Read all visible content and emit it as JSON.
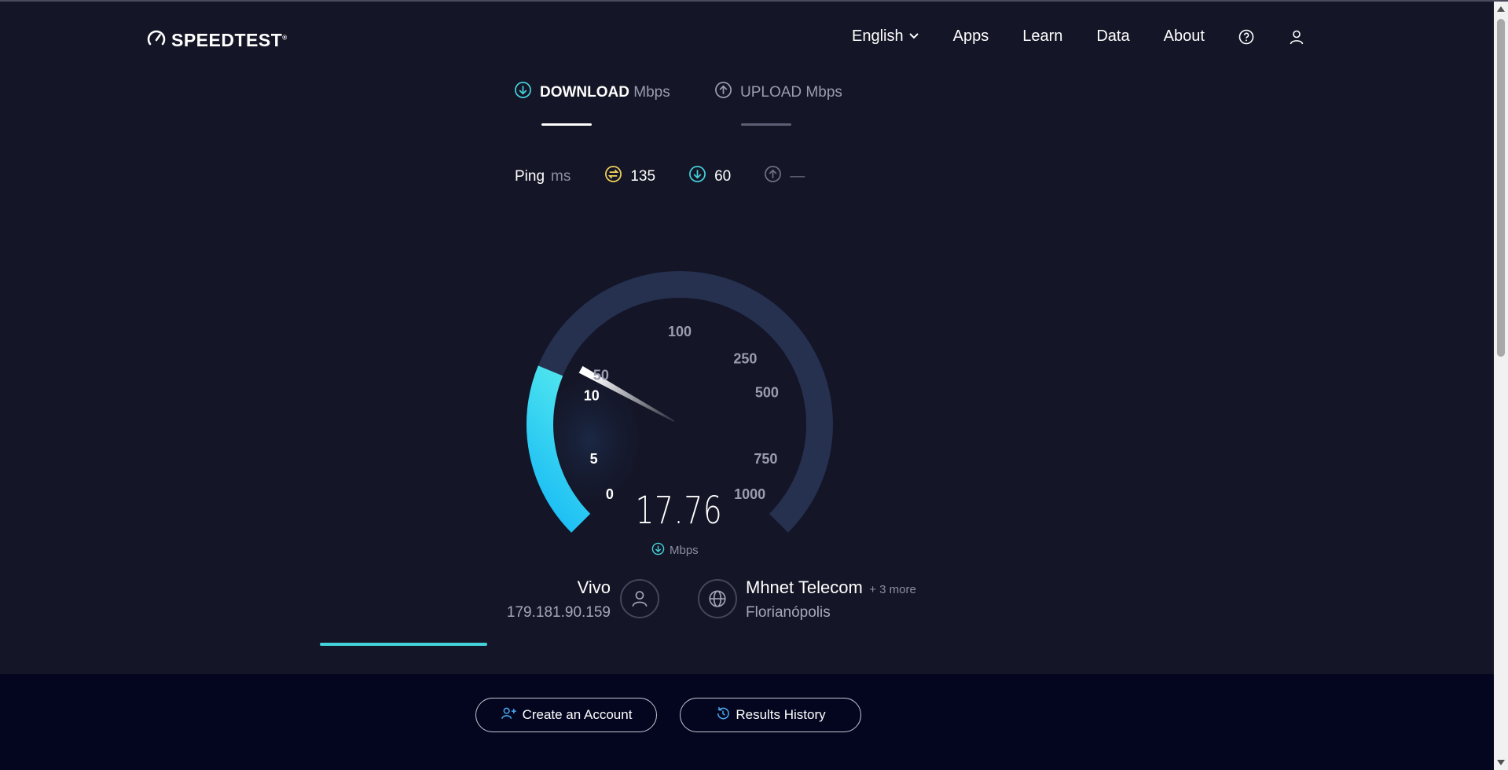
{
  "app": {
    "logo_text": "SPEEDTEST",
    "logo_mark": "®"
  },
  "nav": {
    "language": "English",
    "items": [
      {
        "label": "Apps"
      },
      {
        "label": "Learn"
      },
      {
        "label": "Data"
      },
      {
        "label": "About"
      }
    ],
    "icons": [
      "help-icon",
      "account-icon"
    ]
  },
  "tabs": {
    "download": {
      "label": "DOWNLOAD",
      "unit": "Mbps",
      "active": true
    },
    "upload": {
      "label": "UPLOAD",
      "unit": "Mbps",
      "active": false
    }
  },
  "ping": {
    "label": "Ping",
    "unit": "ms",
    "idle": "135",
    "download": "60",
    "upload": "—"
  },
  "gauge": {
    "ticks": [
      "0",
      "5",
      "10",
      "50",
      "100",
      "250",
      "500",
      "750",
      "1000"
    ],
    "active_tick_count": 3,
    "needle_value": "10",
    "fill_fraction": 0.25,
    "speed": "17.76",
    "speed_unit": "Mbps",
    "colors": {
      "track": "#26304f",
      "fill_start": "#16b9f5",
      "fill_end": "#4ce3ef",
      "tick_active": "#ffffff",
      "tick_inactive": "#9b9cb0"
    }
  },
  "isp": {
    "name": "Vivo",
    "ip": "179.181.90.159"
  },
  "server": {
    "name": "Mhnet Telecom",
    "more": "+ 3 more",
    "location": "Florianópolis"
  },
  "progress": {
    "fraction": 0.11,
    "color": "#43d2d9"
  },
  "footer": {
    "create_account": "Create an Account",
    "results_history": "Results History"
  }
}
